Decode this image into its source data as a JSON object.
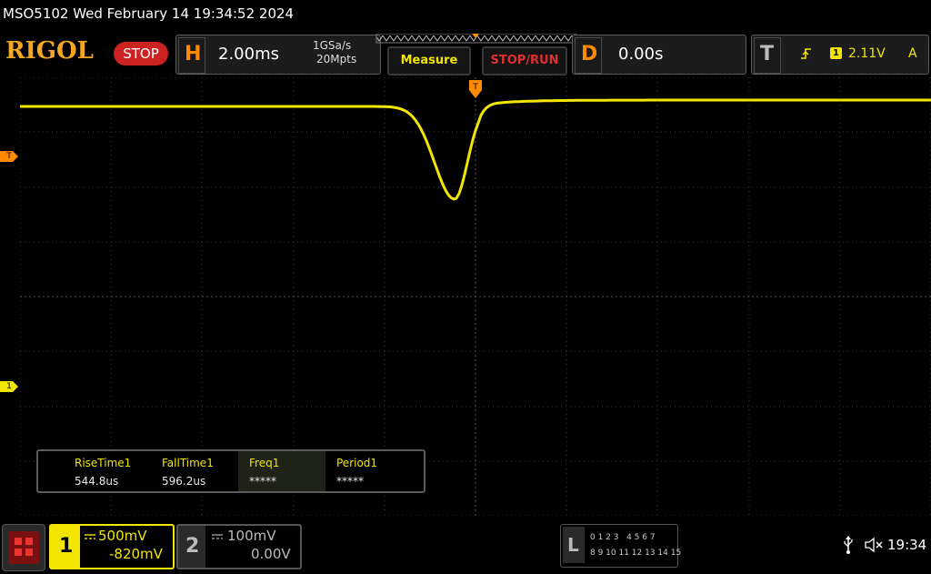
{
  "header": {
    "status_line": "MSO5102  Wed February 14 19:34:52 2024",
    "logo": "RIGOL",
    "run_state": "STOP"
  },
  "horizontal": {
    "letter": "H",
    "timebase": "2.00ms",
    "sample_rate": "1GSa/s",
    "memory_depth": "20Mpts"
  },
  "buttons": {
    "measure": "Measure",
    "stop_run": "STOP/RUN"
  },
  "delay": {
    "letter": "D",
    "value": "0.00s"
  },
  "trigger": {
    "letter": "T",
    "source": "1",
    "level": "2.11V",
    "mode": "A"
  },
  "markers": {
    "trigger_level": "T",
    "trigger_position": "T",
    "channel1": "1"
  },
  "measurements": [
    {
      "name": "RiseTime1",
      "value": "544.8us"
    },
    {
      "name": "FallTime1",
      "value": "596.2us"
    },
    {
      "name": "Freq1",
      "value": "*****"
    },
    {
      "name": "Period1",
      "value": "*****"
    }
  ],
  "channels": [
    {
      "number": "1",
      "scale": "500mV",
      "offset": "-820mV",
      "active": true,
      "color": "#f2e600"
    },
    {
      "number": "2",
      "scale": "100mV",
      "offset": "0.00V",
      "active": false,
      "color": "#9a9a9a"
    }
  ],
  "logic": {
    "letter": "L",
    "row1": "0 1 2 3   4 5 6 7",
    "row2": "8 9 10 11 12 13 14 15"
  },
  "system": {
    "time": "19:34"
  },
  "colors": {
    "trace": "#f2e600",
    "accent": "#ff8a00",
    "stop": "#cc2222"
  }
}
